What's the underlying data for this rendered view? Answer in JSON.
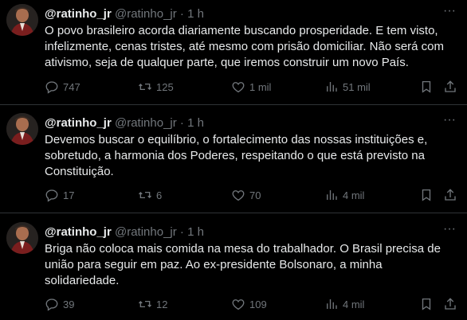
{
  "tweets": [
    {
      "name": "@ratinho_jr",
      "handle": "@ratinho_jr",
      "dot": "·",
      "time": "1 h",
      "text": "O povo brasileiro acorda diariamente buscando prosperidade. E tem visto, infelizmente, cenas tristes, até mesmo com prisão domiciliar. Não será com ativismo, seja de qualquer parte, que iremos construir um novo País.",
      "replies": "747",
      "retweets": "125",
      "likes": "1 mil",
      "views": "51 mil"
    },
    {
      "name": "@ratinho_jr",
      "handle": "@ratinho_jr",
      "dot": "·",
      "time": "1 h",
      "text": "Devemos buscar o equilíbrio, o fortalecimento das nossas instituições e, sobretudo, a harmonia dos Poderes,  respeitando o que está previsto na Constituição.",
      "replies": "17",
      "retweets": "6",
      "likes": "70",
      "views": "4 mil"
    },
    {
      "name": "@ratinho_jr",
      "handle": "@ratinho_jr",
      "dot": "·",
      "time": "1 h",
      "text": "Briga não coloca mais comida na mesa do trabalhador. O Brasil precisa de união para seguir em paz. Ao ex-presidente Bolsonaro, a minha solidariedade.",
      "replies": "39",
      "retweets": "12",
      "likes": "109",
      "views": "4 mil"
    }
  ],
  "colors": {
    "background": "#000000",
    "text": "#e7e9ea",
    "muted": "#71767b",
    "divider": "#2f3336"
  },
  "icons": [
    "more-icon",
    "reply-icon",
    "retweet-icon",
    "like-icon",
    "views-icon",
    "bookmark-icon",
    "share-icon"
  ]
}
